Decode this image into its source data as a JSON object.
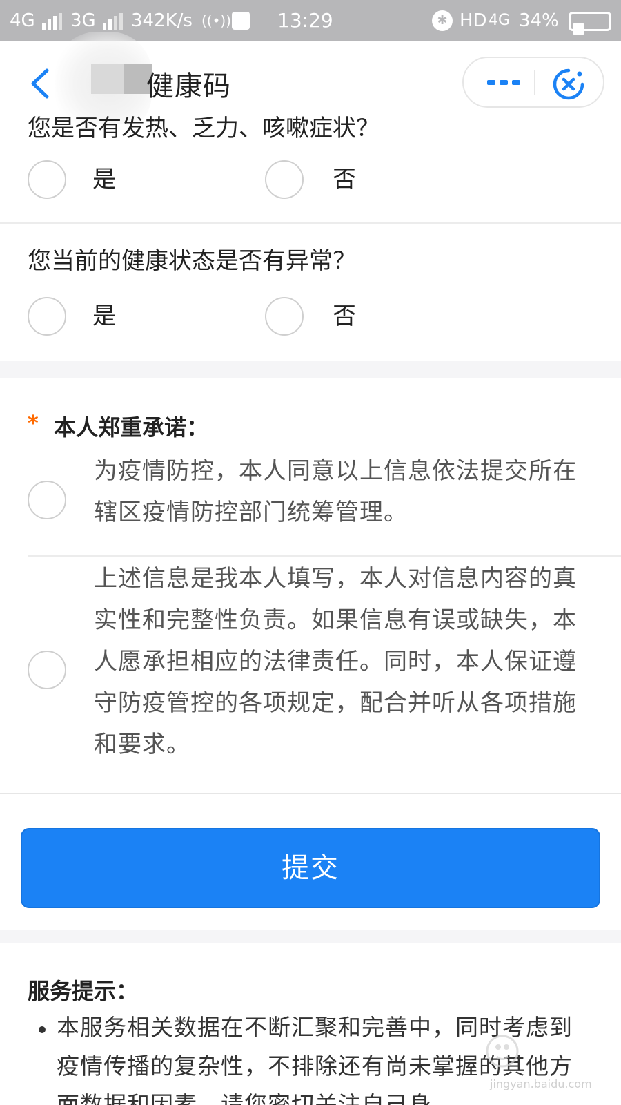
{
  "status_bar": {
    "net1": "4G",
    "net2": "3G",
    "speed": "342K/s",
    "time": "13:29",
    "hd": "HD",
    "net3": "4G",
    "battery": "34%",
    "battery_level": 0.34
  },
  "nav": {
    "title": "健康码"
  },
  "form": {
    "question1_partial": "您是否有发热、乏力、咳嗽症状？",
    "question2": "您当前的健康状态是否有异常？",
    "yes": "是",
    "no": "否"
  },
  "promise": {
    "required_mark": "*",
    "title": "本人郑重承诺：",
    "item1": "为疫情防控，本人同意以上信息依法提交所在辖区疫情防控部门统筹管理。",
    "item2": "上述信息是我本人填写，本人对信息内容的真实性和完整性负责。如果信息有误或缺失，本人愿承担相应的法律责任。同时，本人保证遵守防疫管控的各项规定，配合并听从各项措施和要求。"
  },
  "submit": {
    "label": "提交"
  },
  "tips": {
    "title": "服务提示：",
    "text": "本服务相关数据在不断汇聚和完善中，同时考虑到疫情传播的复杂性，不排除还有尚未掌握的其他方面数据和因素，请您密切关注自己身"
  },
  "watermark": {
    "text": "jingyan.baidu.com"
  },
  "colors": {
    "primary": "#1b82f5",
    "required": "#ff6a00",
    "status_bar": "#b7b7b9"
  }
}
